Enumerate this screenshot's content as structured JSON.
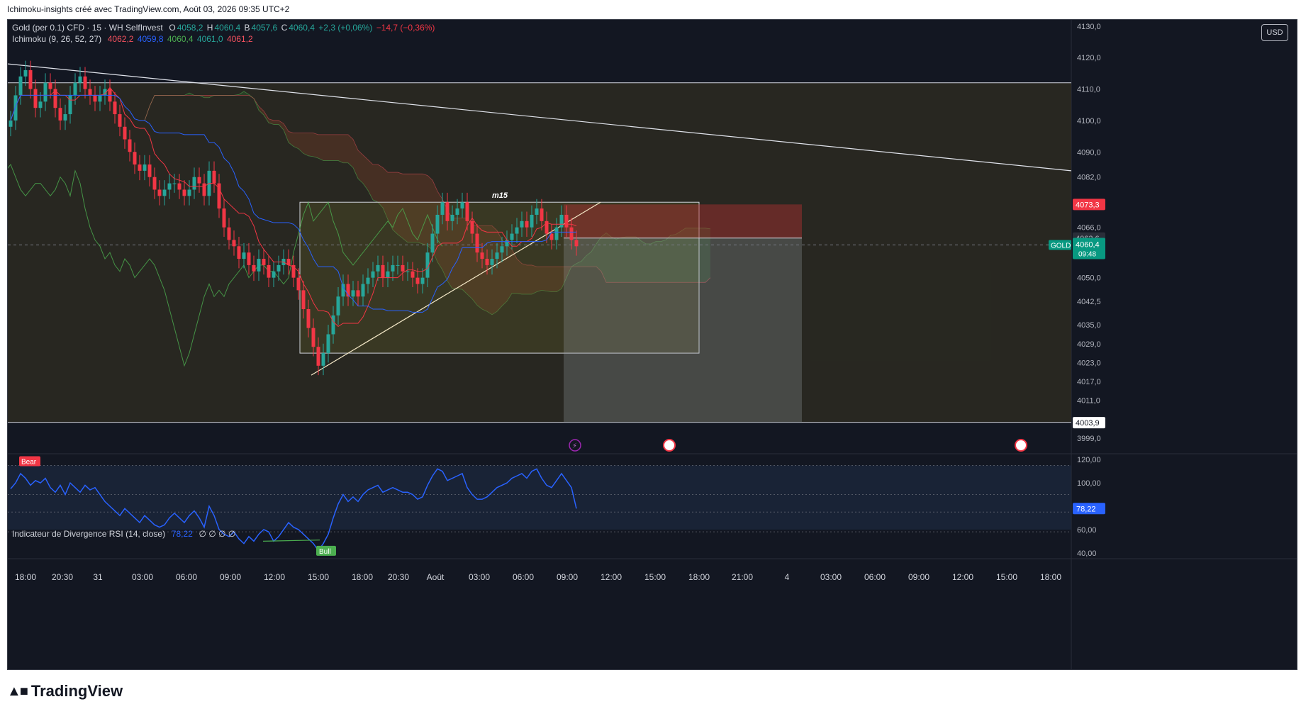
{
  "header": {
    "caption": "Ichimoku-insights créé avec TradingView.com, Août 03, 2026 09:35 UTC+2"
  },
  "legend": {
    "symbol_line": "Gold (per 0.1) CFD · 15 · WH SelfInvest",
    "o_label": "O",
    "o_value": "4058,2",
    "h_label": "H",
    "h_value": "4060,4",
    "b_label": "B",
    "b_value": "4057,6",
    "c_label": "C",
    "c_value": "4060,4",
    "change": "+2,3 (+0,06%)",
    "change2": "−14,7 (−0,36%)",
    "ichimoku_name": "Ichimoku (9, 26, 52, 27)",
    "ichimoku_values": [
      "4062,2",
      "4059,8",
      "4060,4",
      "4061,0",
      "4061,2"
    ],
    "rsi_name": "Indicateur de Divergence RSI (14, close)",
    "rsi_value": "78,22",
    "rsi_extras": "∅ ∅ ∅ ∅"
  },
  "usd_button": "USD",
  "annotations": {
    "m15_label": "m15",
    "bear_label": "Bear",
    "bull_label": "Bull",
    "gold_label": "GOLD"
  },
  "price_badges": {
    "upper": "4073,3",
    "mid": "4062,6",
    "current": "4060,4",
    "countdown": "09:48",
    "lower": "4003,9",
    "rsi": "78,22"
  },
  "footer": {
    "brand": "TradingView"
  },
  "colors": {
    "background": "#131722",
    "up": "#26a69a",
    "down": "#f23645",
    "tenkan": "#f23645",
    "kijun": "#2962ff",
    "chikou": "#4caf50",
    "rsi": "#2962ff"
  },
  "chart_data": {
    "type": "candlestick",
    "instrument": "Gold (per 0.1) CFD",
    "timeframe": "15",
    "y_ticks": [
      "4130,0",
      "4120,0",
      "4110,0",
      "4100,0",
      "4090,0",
      "4082,0",
      "4073,3",
      "4066,0",
      "4062,6",
      "4060,4",
      "4050,0",
      "4042,5",
      "4035,0",
      "4029,0",
      "4023,0",
      "4017,0",
      "4011,0",
      "4003,9",
      "3999,0"
    ],
    "y_tick_values": [
      4130,
      4120,
      4110,
      4100,
      4090,
      4082,
      4073.3,
      4066,
      4062.6,
      4060.4,
      4050,
      4042.5,
      4035,
      4029,
      4023,
      4017,
      4011,
      4003.9,
      3999
    ],
    "ylim": [
      3994,
      4132
    ],
    "x_ticks": [
      "18:00",
      "20:30",
      "31",
      "03:00",
      "06:00",
      "09:00",
      "12:00",
      "15:00",
      "18:00",
      "20:30",
      "Août",
      "03:00",
      "06:00",
      "09:00",
      "12:00",
      "15:00",
      "18:00",
      "21:00",
      "4",
      "03:00",
      "06:00",
      "09:00",
      "12:00",
      "15:00",
      "18:00"
    ],
    "close_series": [
      4100,
      4108,
      4114,
      4116,
      4110,
      4104,
      4106,
      4112,
      4110,
      4104,
      4100,
      4102,
      4108,
      4112,
      4114,
      4110,
      4108,
      4106,
      4108,
      4110,
      4106,
      4102,
      4098,
      4094,
      4090,
      4086,
      4084,
      4086,
      4082,
      4078,
      4076,
      4078,
      4080,
      4080,
      4078,
      4076,
      4078,
      4082,
      4080,
      4076,
      4084,
      4080,
      4072,
      4066,
      4062,
      4060,
      4056,
      4058,
      4054,
      4052,
      4056,
      4054,
      4050,
      4052,
      4054,
      4056,
      4054,
      4050,
      4046,
      4040,
      4034,
      4028,
      4022,
      4026,
      4032,
      4038,
      4044,
      4048,
      4044,
      4046,
      4044,
      4048,
      4050,
      4052,
      4054,
      4050,
      4052,
      4054,
      4054,
      4052,
      4052,
      4050,
      4048,
      4050,
      4058,
      4064,
      4070,
      4074,
      4068,
      4070,
      4072,
      4074,
      4068,
      4064,
      4058,
      4056,
      4054,
      4056,
      4058,
      4060,
      4062,
      4064,
      4066,
      4068,
      4066,
      4070,
      4072,
      4068,
      4064,
      4062,
      4066,
      4070,
      4066,
      4062,
      4060
    ],
    "ichimoku": {
      "tenkan": 9,
      "kijun": 26,
      "senkou_b": 52,
      "displacement": 27
    },
    "rsi": {
      "name": "Indicateur de Divergence RSI (14, close)",
      "y_ticks": [
        "120,00",
        "100,00",
        "60,00",
        "40,00"
      ],
      "y_tick_values": [
        120,
        100,
        60,
        40
      ],
      "ylim": [
        35,
        125
      ],
      "bands": [
        30,
        70
      ],
      "values": [
        95,
        100,
        108,
        104,
        98,
        102,
        100,
        104,
        96,
        92,
        98,
        90,
        100,
        96,
        92,
        98,
        94,
        96,
        90,
        84,
        80,
        76,
        72,
        78,
        74,
        70,
        66,
        72,
        68,
        64,
        62,
        64,
        70,
        74,
        70,
        66,
        72,
        76,
        70,
        62,
        80,
        72,
        60,
        56,
        54,
        58,
        52,
        48,
        54,
        50,
        56,
        60,
        58,
        50,
        54,
        60,
        66,
        62,
        60,
        56,
        52,
        48,
        42,
        48,
        56,
        70,
        82,
        90,
        84,
        88,
        84,
        90,
        94,
        96,
        98,
        92,
        94,
        96,
        94,
        92,
        92,
        90,
        86,
        88,
        98,
        106,
        112,
        110,
        102,
        104,
        106,
        108,
        96,
        90,
        86,
        86,
        88,
        92,
        96,
        98,
        100,
        104,
        106,
        108,
        104,
        110,
        112,
        104,
        98,
        96,
        102,
        108,
        102,
        96,
        78
      ]
    },
    "zones": [
      {
        "name": "range-box",
        "y_top": 4112,
        "y_bottom": 4004
      },
      {
        "name": "m15-box",
        "y_top": 4074,
        "y_bottom": 4026
      },
      {
        "name": "short-stop-zone",
        "y_top": 4073.3,
        "y_bottom": 4062.6
      },
      {
        "name": "short-target-zone",
        "y_top": 4062.6,
        "y_bottom": 4003.9
      }
    ]
  }
}
